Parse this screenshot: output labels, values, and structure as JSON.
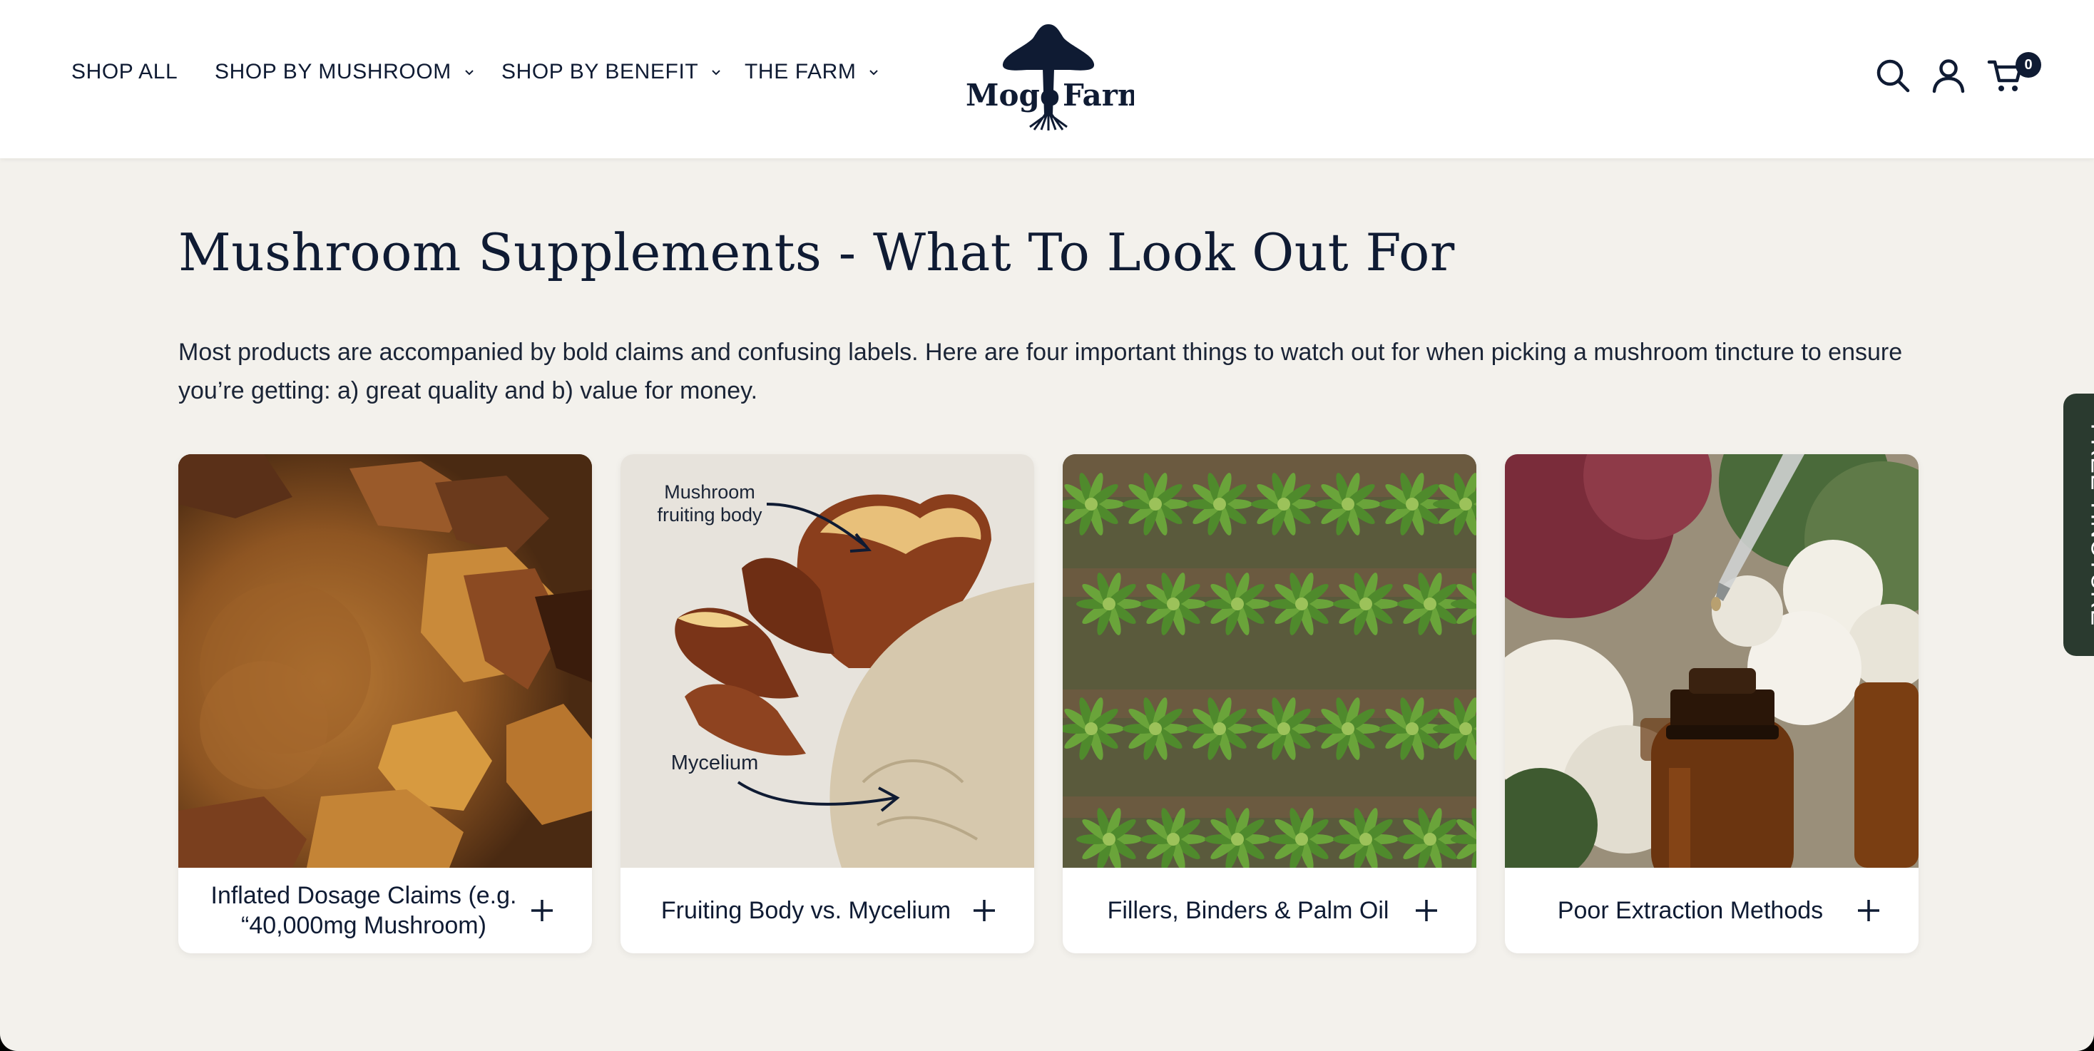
{
  "nav": {
    "items": [
      {
        "label": "SHOP ALL",
        "has_dropdown": false
      },
      {
        "label": "SHOP BY MUSHROOM",
        "has_dropdown": true
      },
      {
        "label": "SHOP BY BENEFIT",
        "has_dropdown": true
      },
      {
        "label": "THE FARM",
        "has_dropdown": true
      }
    ]
  },
  "logo": {
    "left_word": "Mogo",
    "right_word": "Farm"
  },
  "header_icons": {
    "search": "search-icon",
    "account": "user-icon",
    "cart": "cart-icon",
    "cart_count": "0"
  },
  "section": {
    "title": "Mushroom Supplements - What To Look Out For",
    "intro": "Most products are accompanied by bold claims and confusing labels. Here are four important things to watch out for when picking a mushroom tincture to ensure you’re getting: a) great quality and b) value for money."
  },
  "cards": [
    {
      "label": "Inflated Dosage Claims (e.g. “40,000mg Mushroom)",
      "image": "mushroom-powder-chunks"
    },
    {
      "label": "Fruiting Body vs. Mycelium",
      "image": "reishi-fruiting-body",
      "annotations": {
        "fruiting_body": [
          "Mushroom",
          "fruiting body"
        ],
        "mycelium": "Mycelium"
      }
    },
    {
      "label": "Fillers, Binders & Palm Oil",
      "image": "palm-plantation-aerial"
    },
    {
      "label": "Poor Extraction Methods",
      "image": "tincture-dropper-bottle"
    }
  ],
  "side_tab": {
    "label": "FREE TINCTURE"
  },
  "colors": {
    "navy": "#0f1b33",
    "page_bg": "#f3f1ec",
    "side_tab": "#2a3a2f",
    "header_bg": "#ffffff"
  }
}
